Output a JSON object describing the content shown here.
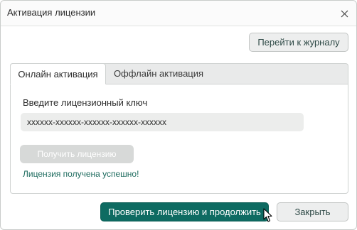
{
  "dialog": {
    "title": "Активация лицензии",
    "close_icon": "close-icon"
  },
  "toolbar": {
    "journal_label": "Перейти к журналу"
  },
  "tabs": [
    {
      "label": "Онлайн активация",
      "active": true
    },
    {
      "label": "Оффлайн активация",
      "active": false
    }
  ],
  "online": {
    "key_label": "Введите лицензионный ключ",
    "key_value": "xxxxxx-xxxxxx-xxxxxx-xxxxxx-xxxxxx",
    "get_license_label": "Получить лицензию",
    "get_license_enabled": false,
    "status_text": "Лицензия получена успешно!"
  },
  "footer": {
    "primary_label": "Проверить лицензию и продолжить",
    "close_label": "Закрыть"
  },
  "colors": {
    "accent": "#0e6b62",
    "success_text": "#1d6b5e",
    "disabled_button": "#d7d9d8"
  },
  "cursor_icon": "mouse-pointer-icon"
}
